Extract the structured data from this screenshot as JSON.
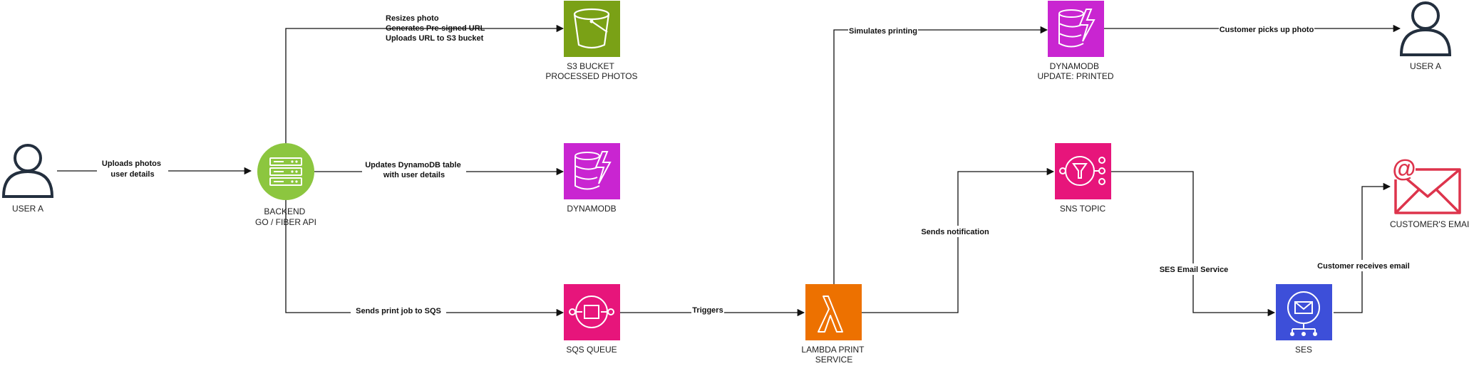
{
  "colors": {
    "s3": "#7AA116",
    "dynamodb": "#C925D1",
    "sqs": "#E7157B",
    "lambda": "#ED7100",
    "sns": "#E7157B",
    "ses": "#3D4FD9",
    "backend": "#8CC63F",
    "email": "#DD344C",
    "user": "#232F3E",
    "edge": "#111111"
  },
  "nodes": {
    "user_a_left": {
      "icon": "user-icon",
      "label": [
        "USER A"
      ]
    },
    "backend": {
      "icon": "server-icon",
      "label": [
        "BACKEND",
        "GO / FIBER API"
      ]
    },
    "s3": {
      "icon": "s3-bucket-icon",
      "label": [
        "S3 BUCKET",
        "PROCESSED PHOTOS"
      ]
    },
    "dynamodb": {
      "icon": "dynamodb-icon",
      "label": [
        "DYNAMODB"
      ]
    },
    "sqs": {
      "icon": "sqs-icon",
      "label": [
        "SQS QUEUE"
      ]
    },
    "lambda": {
      "icon": "lambda-icon",
      "label": [
        "LAMBDA PRINT",
        "SERVICE"
      ]
    },
    "dynamodb_printed": {
      "icon": "dynamodb-icon",
      "label": [
        "DYNAMODB",
        "UPDATE: PRINTED"
      ]
    },
    "sns": {
      "icon": "sns-topic-icon",
      "label": [
        "SNS TOPIC"
      ]
    },
    "ses": {
      "icon": "ses-icon",
      "label": [
        "SES"
      ]
    },
    "user_a_right": {
      "icon": "user-icon",
      "label": [
        "USER A"
      ]
    },
    "email": {
      "icon": "email-icon",
      "label": [
        "CUSTOMER'S EMAIL"
      ]
    }
  },
  "edges": {
    "uploads": [
      "Uploads photos",
      "user details"
    ],
    "s3": [
      "Resizes photo",
      "Generates Pre-signed URL",
      "Uploads URL to S3 bucket"
    ],
    "dynamo": [
      "Updates DynamoDB table",
      "with user details"
    ],
    "sqs": [
      "Sends print job to SQS"
    ],
    "triggers": [
      "Triggers"
    ],
    "simulates": [
      "Simulates printing"
    ],
    "pickup": [
      "Customer picks up photo"
    ],
    "notify": [
      "Sends notification"
    ],
    "ses_service": [
      "SES Email Service"
    ],
    "receives": [
      "Customer receives email"
    ]
  }
}
